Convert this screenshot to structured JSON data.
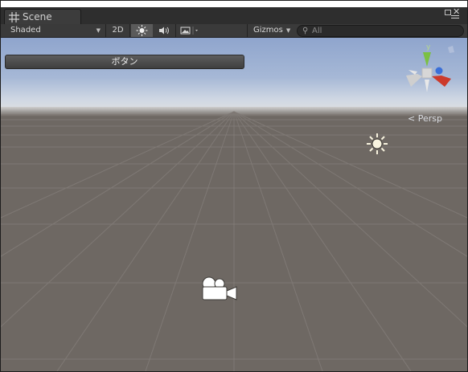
{
  "tab": {
    "title": "Scene"
  },
  "toolbar": {
    "shading_mode": "Shaded",
    "mode_2d": "2D",
    "gizmos": "Gizmos",
    "search_placeholder": "All"
  },
  "viewport": {
    "gui_button": "ボタン",
    "gizmo_axis_label": "y",
    "projection_label": "Persp",
    "colors": {
      "sky_top": "#8fa5cd",
      "ground": "#6e6863",
      "axis_y": "#7bc043",
      "axis_x": "#cc3a2b",
      "axis_z": "#3a6fd8"
    }
  },
  "icons": [
    "grid-icon",
    "maximize-icon",
    "close-icon",
    "menu-icon",
    "lighting-icon",
    "audio-icon",
    "effects-icon",
    "search-icon",
    "sun-icon",
    "camera-icon",
    "scene-gizmo"
  ]
}
